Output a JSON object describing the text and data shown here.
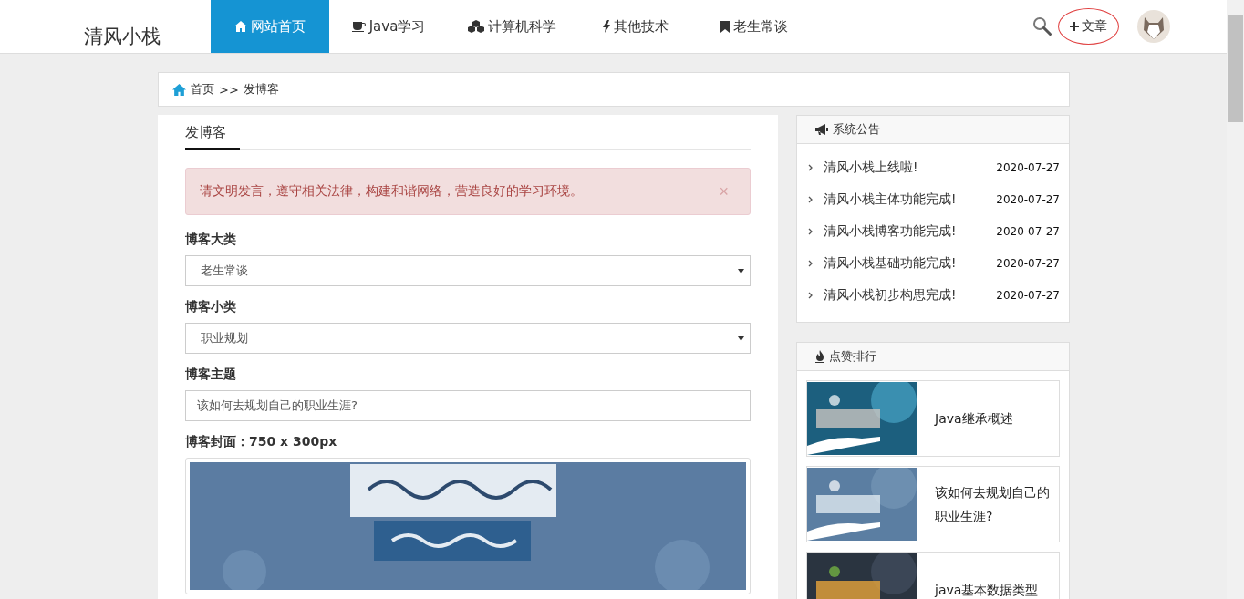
{
  "header": {
    "logo": "清风小栈",
    "nav": [
      {
        "label": "网站首页",
        "selected": true
      },
      {
        "label": "Java学习",
        "selected": false
      },
      {
        "label": "计算机科学",
        "selected": false
      },
      {
        "label": "其他技术",
        "selected": false
      },
      {
        "label": "老生常谈",
        "selected": false
      }
    ],
    "write_button": "文章"
  },
  "breadcrumb": [
    "首页",
    ">>",
    "发博客"
  ],
  "form": {
    "tab": "发博客",
    "alert": {
      "text": "请文明发言，遵守相关法律，构建和谐网络，营造良好的学习环境。",
      "close": "×"
    },
    "fields": [
      {
        "kind": "select",
        "label": "博客大类",
        "value": "老生常谈"
      },
      {
        "kind": "select",
        "label": "博客小类",
        "value": "职业规划"
      },
      {
        "kind": "text",
        "label": "博客主题",
        "value": "该如何去规划自己的职业生涯?"
      },
      {
        "label": "博客封面：750 x 300px"
      }
    ]
  },
  "notices": {
    "title": "系统公告",
    "items": [
      {
        "title": "清风小栈上线啦!",
        "date": "2020-07-27"
      },
      {
        "title": "清风小栈主体功能完成!",
        "date": "2020-07-27"
      },
      {
        "title": "清风小栈博客功能完成!",
        "date": "2020-07-27"
      },
      {
        "title": "清风小栈基础功能完成!",
        "date": "2020-07-27"
      },
      {
        "title": "清风小栈初步构思完成!",
        "date": "2020-07-27"
      }
    ]
  },
  "ranking": {
    "title": "点赞排行",
    "items": [
      {
        "title": "Java继承概述",
        "kind": "picture"
      },
      {
        "title": "该如何去规划自己的职业生涯?",
        "kind": "picture"
      },
      {
        "title": "java基本数据类型",
        "kind": "picture"
      }
    ]
  }
}
